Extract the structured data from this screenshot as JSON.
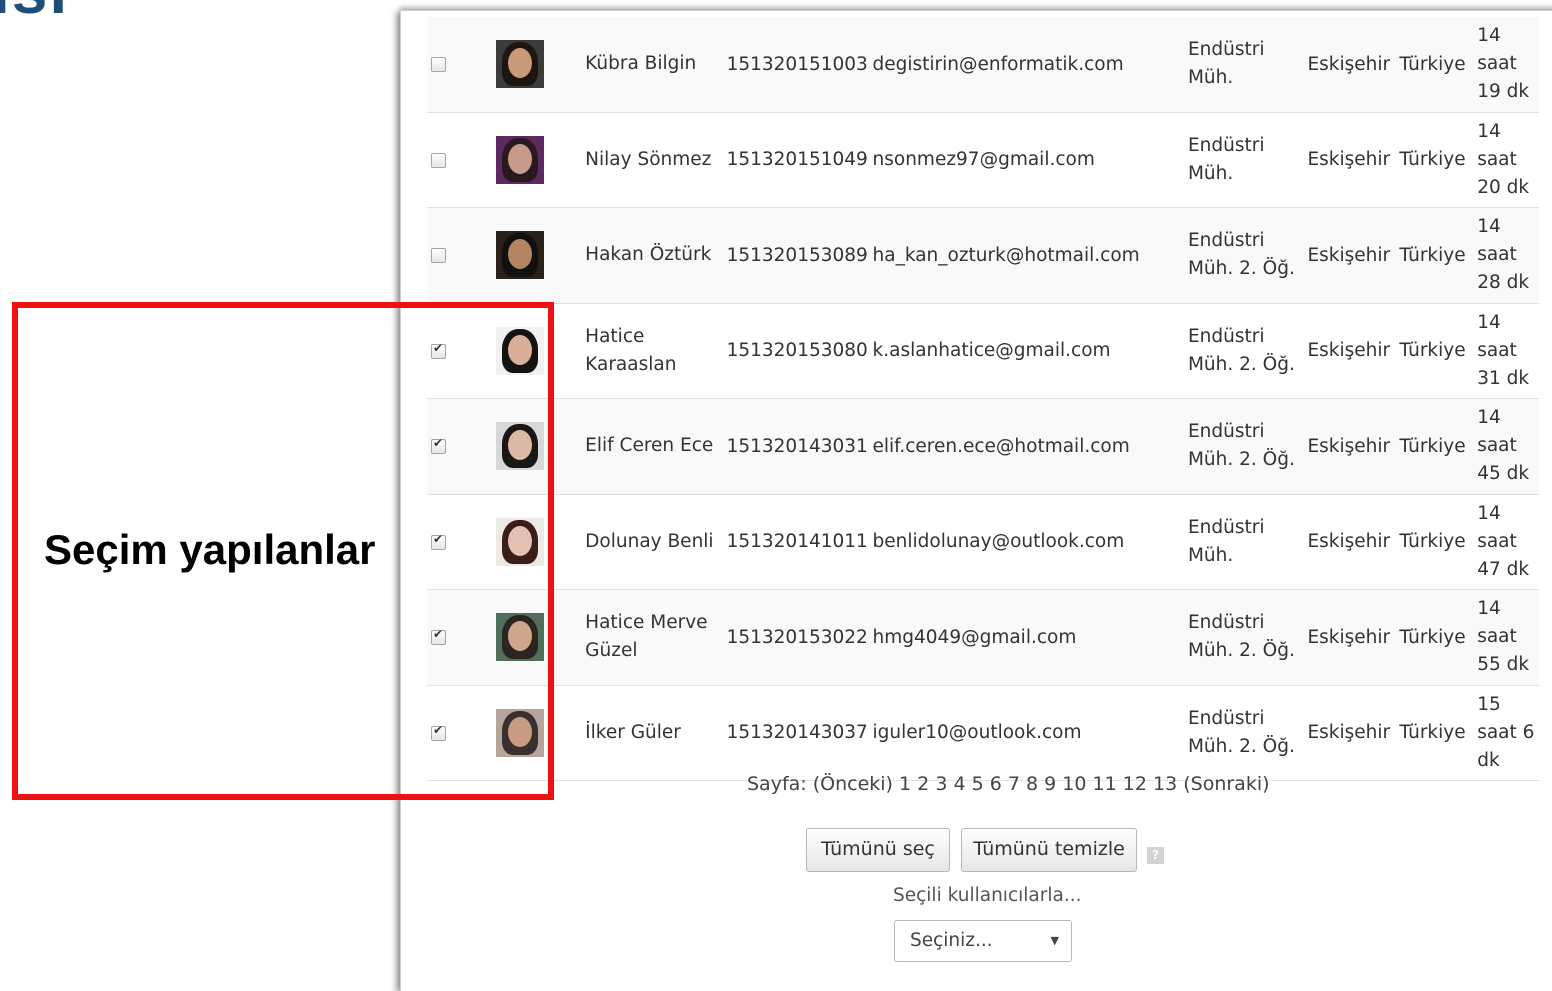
{
  "slide": {
    "title_fragment": "ısı",
    "annotation_label": "Seçim yapılanlar"
  },
  "users": [
    {
      "checked": false,
      "name": "Kübra Bilgin",
      "id": "151320151003",
      "email": "degistirin@enformatik.com",
      "department": "Endüstri Müh.",
      "city": "Eskişehir",
      "country": "Türkiye",
      "time": "14 saat 19 dk",
      "avatar_colors": {
        "bg": "#3b3b3b",
        "hair": "#1e1510",
        "face": "#c99a78"
      }
    },
    {
      "checked": false,
      "name": "Nilay Sönmez",
      "id": "151320151049",
      "email": "nsonmez97@gmail.com",
      "department": "Endüstri Müh.",
      "city": "Eskişehir",
      "country": "Türkiye",
      "time": "14 saat 20 dk",
      "avatar_colors": {
        "bg": "#5a2a60",
        "hair": "#2a1a20",
        "face": "#c69a8a"
      }
    },
    {
      "checked": false,
      "name": "Hakan Öztürk",
      "id": "151320153089",
      "email": "ha_kan_ozturk@hotmail.com",
      "department": "Endüstri Müh. 2. Öğ.",
      "city": "Eskişehir",
      "country": "Türkiye",
      "time": "14 saat 28 dk",
      "avatar_colors": {
        "bg": "#2a2218",
        "hair": "#111111",
        "face": "#b58563"
      }
    },
    {
      "checked": true,
      "name": "Hatice Karaaslan",
      "id": "151320153080",
      "email": "k.aslanhatice@gmail.com",
      "department": "Endüstri Müh. 2. Öğ.",
      "city": "Eskişehir",
      "country": "Türkiye",
      "time": "14 saat 31 dk",
      "avatar_colors": {
        "bg": "#f1f1f1",
        "hair": "#161210",
        "face": "#d8b09a"
      }
    },
    {
      "checked": true,
      "name": "Elif Ceren Ece",
      "id": "151320143031",
      "email": "elif.ceren.ece@hotmail.com",
      "department": "Endüstri Müh. 2. Öğ.",
      "city": "Eskişehir",
      "country": "Türkiye",
      "time": "14 saat 45 dk",
      "avatar_colors": {
        "bg": "#d8d8d8",
        "hair": "#1b1714",
        "face": "#d9b8a6"
      }
    },
    {
      "checked": true,
      "name": "Dolunay Benli",
      "id": "151320141011",
      "email": "benlidolunay@outlook.com",
      "department": "Endüstri Müh.",
      "city": "Eskişehir",
      "country": "Türkiye",
      "time": "14 saat 47 dk",
      "avatar_colors": {
        "bg": "#efe9e6",
        "hair": "#3a1e1a",
        "face": "#e4c0b2"
      }
    },
    {
      "checked": true,
      "name": "Hatice Merve Güzel",
      "id": "151320153022",
      "email": "hmg4049@gmail.com",
      "department": "Endüstri Müh. 2. Öğ.",
      "city": "Eskişehir",
      "country": "Türkiye",
      "time": "14 saat 55 dk",
      "avatar_colors": {
        "bg": "#4f6f5a",
        "hair": "#2b2420",
        "face": "#cfa68c"
      }
    },
    {
      "checked": true,
      "name": "İlker Güler",
      "id": "151320143037",
      "email": "iguler10@outlook.com",
      "department": "Endüstri Müh. 2. Öğ.",
      "city": "Eskişehir",
      "country": "Türkiye",
      "time": "15 saat 6 dk",
      "avatar_colors": {
        "bg": "#b8a59a",
        "hair": "#3a3030",
        "face": "#c99b80"
      }
    }
  ],
  "pagination": {
    "label": "Sayfa:",
    "prev": "(Önceki)",
    "pages": [
      "1",
      "2",
      "3",
      "4",
      "5",
      "6",
      "7",
      "8",
      "9",
      "10",
      "11",
      "12",
      "13"
    ],
    "next": "(Sonraki)"
  },
  "actions": {
    "select_all": "Tümünü seç",
    "clear_all": "Tümünü temizle",
    "help_icon": "?",
    "with_selected_label": "Seçili kullanıcılarla...",
    "select_value": "Seçiniz...",
    "select_arrow": "▼"
  },
  "colors": {
    "highlight_border": "#ee1111",
    "title_color": "#1f4e79"
  }
}
